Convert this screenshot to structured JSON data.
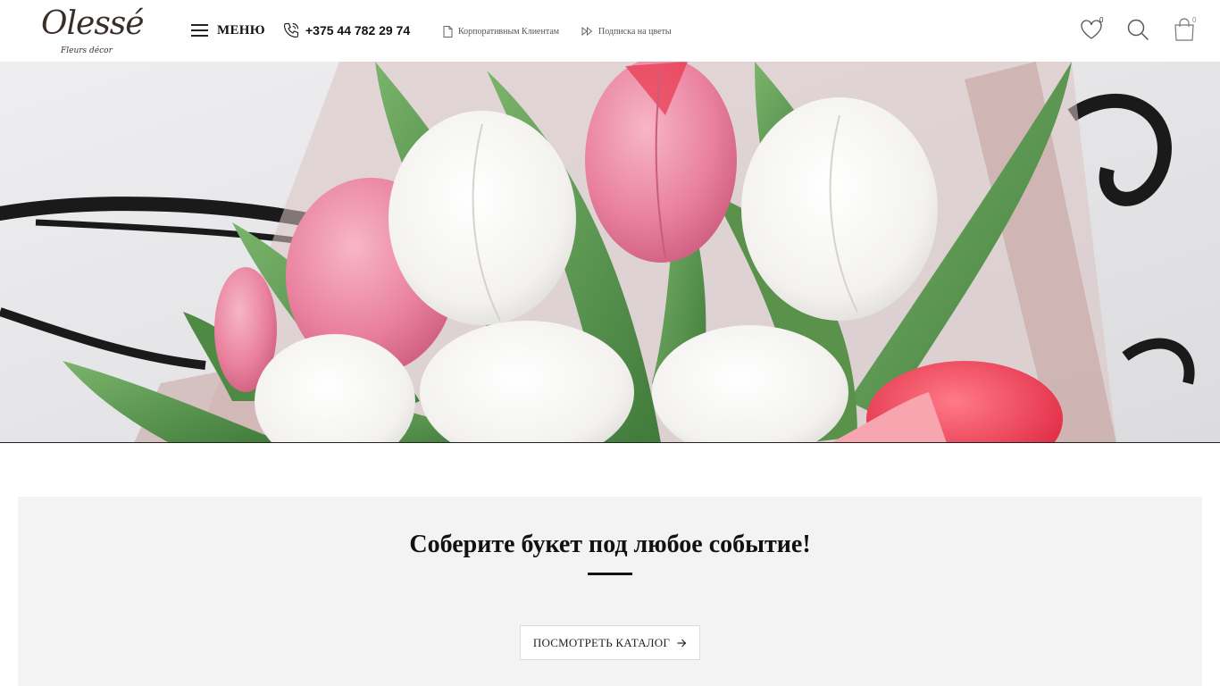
{
  "brand": {
    "logo_text": "Olessé",
    "logo_sub": "Fleurs décor"
  },
  "header": {
    "menu_label": "МЕНЮ",
    "phone": "+375 44 782 29 74",
    "links": [
      {
        "label": "Корпоративным Клиентам",
        "icon": "document-icon"
      },
      {
        "label": "Подписка на цветы",
        "icon": "fast-forward-icon"
      }
    ],
    "wishlist_count": "0",
    "cart_count": "0"
  },
  "hero": {
    "image": "tulip-bouquet-photo"
  },
  "promo": {
    "title": "Соберите букет под любое событие!",
    "button_label": "ПОСМОТРЕТЬ КАТАЛОГ"
  },
  "colors": {
    "accent": "#111111",
    "promo_bg": "#f3f3f3",
    "tulip_pink": "#e87a9a",
    "tulip_red": "#e8344a",
    "leaf_green": "#5f9a52"
  }
}
